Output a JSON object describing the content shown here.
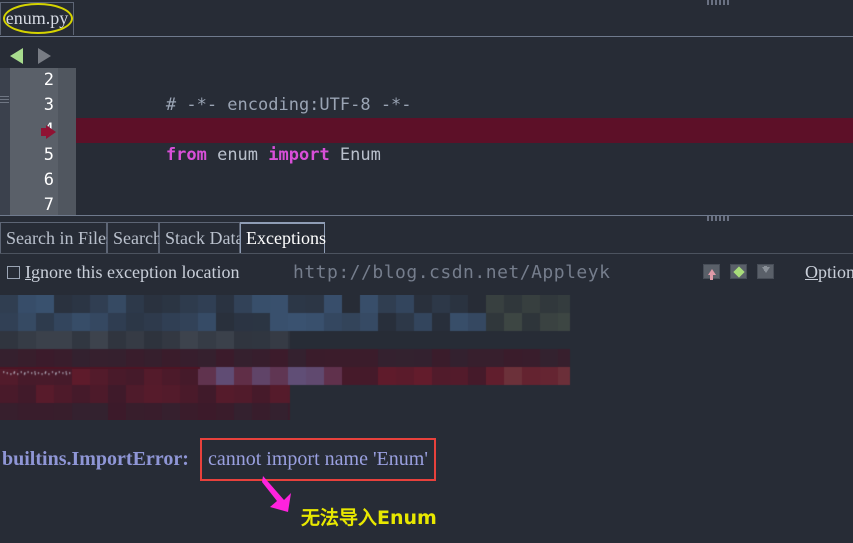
{
  "editor": {
    "tab": {
      "label": "enum.py"
    },
    "nav": {
      "back_icon": "triangle-left-icon",
      "forward_icon": "triangle-right-icon"
    },
    "gutter": {
      "line_numbers": [
        "2",
        "3",
        "4",
        "5",
        "6",
        "7"
      ]
    },
    "marker": {
      "icon": "debug-current-line-arrow-icon",
      "line": "4"
    },
    "code": {
      "lines": [
        {
          "number": "2",
          "text": "# -*- encoding:UTF-8 -*-",
          "highlighted": false
        },
        {
          "number": "3",
          "text": "",
          "highlighted": false
        },
        {
          "number": "4",
          "text": "from enum import Enum",
          "highlighted": true
        },
        {
          "number": "5",
          "text": "",
          "highlighted": false
        },
        {
          "number": "6",
          "text": "",
          "highlighted": false
        },
        {
          "number": "7",
          "text": "",
          "highlighted": false
        }
      ],
      "line4_tokens": [
        {
          "text": "from",
          "kind": "keyword"
        },
        {
          "text": " enum ",
          "kind": "plain"
        },
        {
          "text": "import",
          "kind": "keyword"
        },
        {
          "text": " Enum",
          "kind": "plain"
        }
      ],
      "line2_text": "# -*- encoding:UTF-8 -*-"
    }
  },
  "console": {
    "tabs": [
      {
        "label": "Search in Files",
        "active": false
      },
      {
        "label": "Search",
        "active": false
      },
      {
        "label": "Stack Data",
        "active": false
      },
      {
        "label": "Exceptions",
        "active": true
      }
    ],
    "ignore_checkbox": {
      "label_pre": "",
      "label_mnemonic": "I",
      "label_post": "gnore this exception location",
      "checked": false
    },
    "watermark": "http://blog.csdn.net/Appleyk",
    "icons": [
      {
        "name": "arrow-up-icon"
      },
      {
        "name": "diamond-icon"
      },
      {
        "name": "arrow-down-icon"
      }
    ],
    "options_link": {
      "mnemonic": "O",
      "rest": "ptions"
    },
    "error": {
      "prefix": "builtins.ImportError:",
      "detail": "cannot import name 'Enum'"
    }
  },
  "annotations": {
    "tab_ellipse": {
      "shape": "ellipse",
      "color": "#d6d400",
      "target": "enum.py"
    },
    "error_box": {
      "shape": "rectangle",
      "color": "#e8413c",
      "target": "cannot import name 'Enum'"
    },
    "arrow": {
      "shape": "arrow",
      "color": "#ff22dd",
      "direction": "up-right"
    },
    "caption": {
      "text": "无法导入Enum",
      "color": "#e8e800"
    }
  },
  "colors": {
    "background": "#272c36",
    "gutter": "#5a6069",
    "highlight_line": "#5d1028",
    "keyword": "#d94fd9",
    "comment": "#9aa4b4",
    "code_plain": "#b9c0cc",
    "error_text": "#9aa0e0",
    "annotation_yellow": "#d6d400",
    "annotation_red": "#e8413c",
    "annotation_magenta": "#ff22dd"
  }
}
